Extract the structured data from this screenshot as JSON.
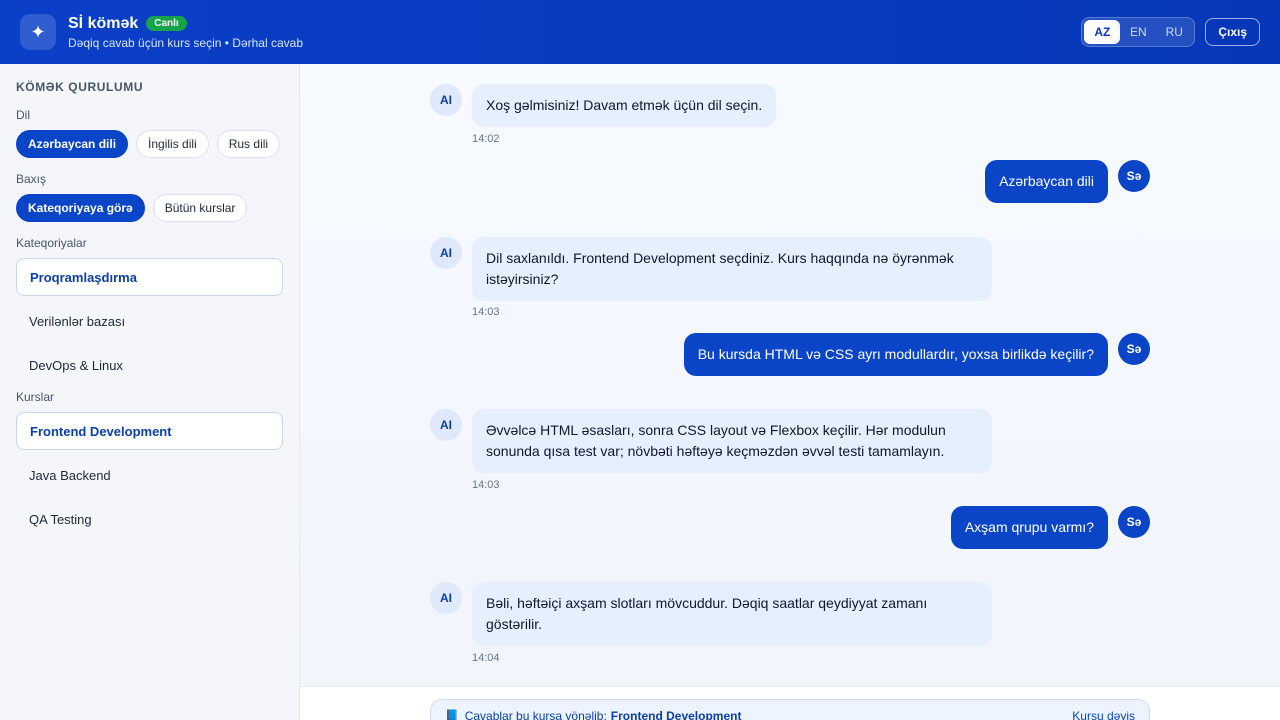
{
  "header": {
    "title": "Sİ kömək",
    "badge": "Canlı",
    "subtitle": "Dəqiq cavab üçün kurs seçin • Dərhal cavab",
    "languages": [
      "AZ",
      "EN",
      "RU"
    ],
    "active_language": "AZ",
    "logout_label": "Çıxış"
  },
  "sidebar": {
    "title": "KÖMƏK QURULUMU",
    "language_label": "Dil",
    "language_options": [
      "Azərbaycan dili",
      "İngilis dili",
      "Rus dili"
    ],
    "view_label": "Baxış",
    "view_options": [
      "Kateqoriyaya görə",
      "Bütün kurslar"
    ],
    "categories_label": "Kateqoriyalar",
    "categories": [
      "Proqramlaşdırma",
      "Verilənlər bazası",
      "DevOps & Linux"
    ],
    "courses_label": "Kurslar",
    "courses": [
      "Frontend Development",
      "Java Backend",
      "QA Testing"
    ]
  },
  "chat": {
    "ai_avatar": "AI",
    "user_avatar": "Sə",
    "messages": [
      {
        "role": "ai",
        "text": "Xoş gəlmisiniz! Davam etmək üçün dil seçin.",
        "time": "14:02"
      },
      {
        "role": "user",
        "text": "Azərbaycan dili"
      },
      {
        "role": "ai",
        "text": "Dil saxlanıldı. Frontend Development seçdiniz. Kurs haqqında nə öyrənmək istəyirsiniz?",
        "time": "14:03"
      },
      {
        "role": "user",
        "text": "Bu kursda HTML və CSS ayrı modullardır, yoxsa birlikdə keçilir?"
      },
      {
        "role": "ai",
        "text": "Əvvəlcə HTML əsasları, sonra CSS layout və Flexbox keçilir. Hər modulun sonunda qısa test var; növbəti həftəyə keçməzdən əvvəl testi tamamlayın.",
        "time": "14:03"
      },
      {
        "role": "user",
        "text": "Axşam qrupu varmı?"
      },
      {
        "role": "ai",
        "text": "Bəli, həftəiçi axşam slotları mövcuddur. Dəqiq saatlar qeydiyyat zamanı göstərilir.",
        "time": "14:04"
      }
    ]
  },
  "context": {
    "book_icon": "book-icon",
    "prefix": "Cavablar bu kursa yönəlib:",
    "course": "Frontend Development",
    "change_label": "Kursu dəyiş"
  },
  "colors": {
    "primary": "#0a45c8",
    "header": "#0637b8",
    "ai_bubble": "#e6effd",
    "live_badge": "#16a34a"
  }
}
